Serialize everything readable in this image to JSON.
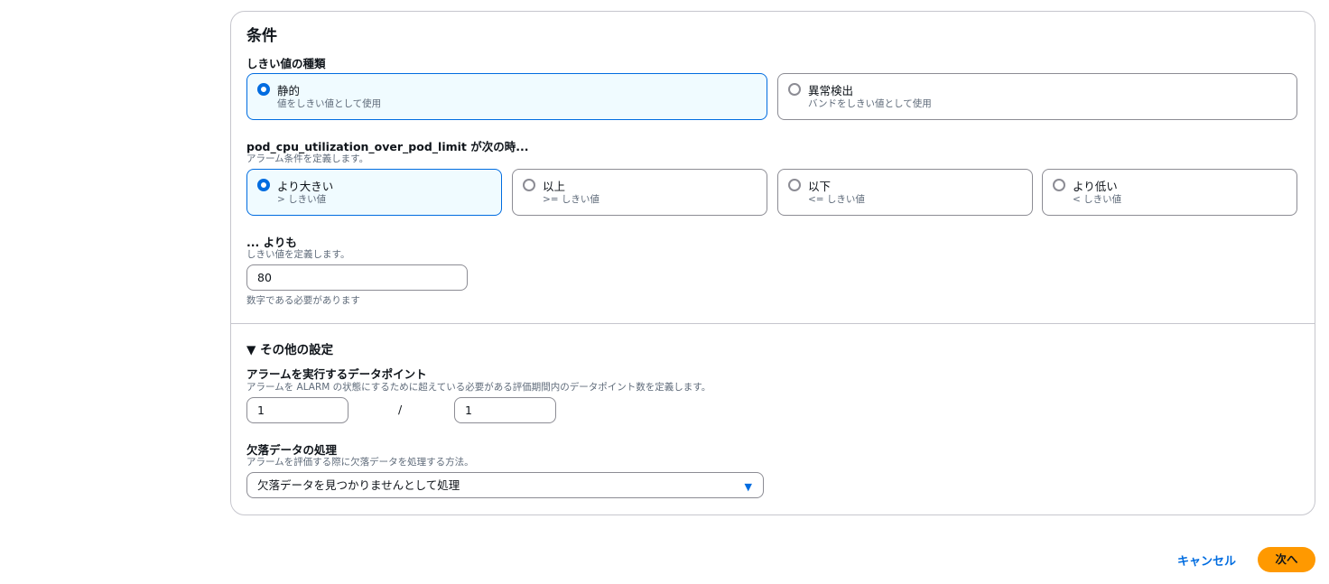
{
  "conditions": {
    "title": "条件",
    "threshold_type": {
      "label": "しきい値の種類",
      "options": [
        {
          "title": "静的",
          "sub": "値をしきい値として使用",
          "selected": true
        },
        {
          "title": "異常検出",
          "sub": "バンドをしきい値として使用",
          "selected": false
        }
      ]
    },
    "operator": {
      "label": "pod_cpu_utilization_over_pod_limit が次の時...",
      "desc": "アラーム条件を定義します。",
      "options": [
        {
          "title": "より大きい",
          "sub": "> しきい値",
          "selected": true
        },
        {
          "title": "以上",
          "sub": ">= しきい値",
          "selected": false
        },
        {
          "title": "以下",
          "sub": "<= しきい値",
          "selected": false
        },
        {
          "title": "より低い",
          "sub": "< しきい値",
          "selected": false
        }
      ]
    },
    "threshold": {
      "label": "... よりも",
      "desc": "しきい値を定義します。",
      "value": "80",
      "hint": "数字である必要があります"
    }
  },
  "additional": {
    "toggle_label": "▼ その他の設定",
    "datapoints": {
      "label": "アラームを実行するデータポイント",
      "desc": "アラームを ALARM の状態にするために超えている必要がある評価期間内のデータポイント数を定義します。",
      "value1": "1",
      "separator": "/",
      "value2": "1"
    },
    "missing_data": {
      "label": "欠落データの処理",
      "desc": "アラームを評価する際に欠落データを処理する方法。",
      "selected": "欠落データを見つかりませんとして処理"
    }
  },
  "footer": {
    "cancel": "キャンセル",
    "next": "次へ"
  },
  "colors": {
    "accent": "#006ce0",
    "primary_button": "#ff9900"
  }
}
